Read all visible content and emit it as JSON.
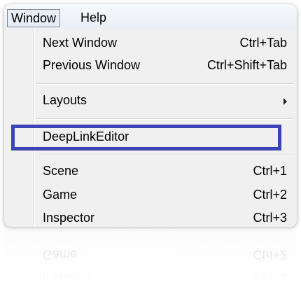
{
  "menubar": {
    "items": [
      {
        "label": "Window"
      },
      {
        "label": "Help"
      }
    ]
  },
  "menu": {
    "items": [
      {
        "label": "Next Window",
        "shortcut": "Ctrl+Tab"
      },
      {
        "label": "Previous Window",
        "shortcut": "Ctrl+Shift+Tab"
      },
      {
        "label": "Layouts",
        "has_submenu": true
      },
      {
        "label": "DeepLinkEditor",
        "highlighted": true
      },
      {
        "label": "Scene",
        "shortcut": "Ctrl+1"
      },
      {
        "label": "Game",
        "shortcut": "Ctrl+2"
      },
      {
        "label": "Inspector",
        "shortcut": "Ctrl+3"
      }
    ]
  },
  "colors": {
    "highlight_border": "#3b43b6",
    "menu_background": "#f0f0f0"
  }
}
